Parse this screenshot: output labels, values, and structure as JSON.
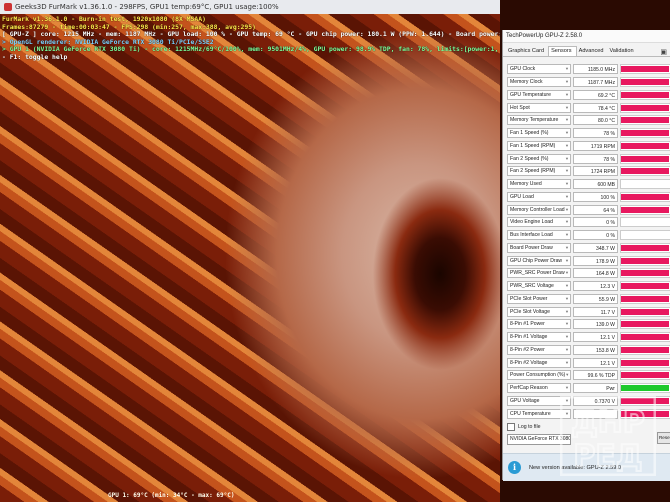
{
  "furmark": {
    "title": "Geeks3D FurMark v1.36.1.0 - 298FPS, GPU1 temp:69°C, GPU1 usage:100%",
    "overlay": [
      {
        "text": "FurMark v1.36.1.0 - Burn-in test, 1920x1080 (8X MSAA)",
        "color": "y"
      },
      {
        "text": "Frames:87279 - time:00:03:47 - FPS:298 (min:257, max:388, avg:295)",
        "color": "y"
      },
      {
        "text": "[ GPU-Z ] core: 1215 MHz - mem: 1187 MHz - GPU load: 100 % - GPU temp: 69 °C - GPU chip power: 180.1 W (PPW: 1.644) - Board power: 348.7 W (PPW: 0.848) - GPU voltage: 0.737 V",
        "color": "w"
      },
      {
        "text": "> OpenGL renderer: NVIDIA GeForce RTX 3080 Ti/PCIe/SSE2",
        "color": "c"
      },
      {
        "text": "> GPU 1 (NVIDIA GeForce RTX 3080 Ti) - core: 1215MHz/69°C/100%, mem: 9501MHz/4%, GPU power: 98.9% TDP, fan: 78%, limits:[power:1, temp:0, volt:0, OV:0]",
        "color": "g"
      },
      {
        "text": "- F1: toggle help",
        "color": "w"
      }
    ],
    "footer": "GPU 1: 69°C (min: 34°C - max: 69°C)"
  },
  "gpuz": {
    "title": "TechPowerUp GPU-Z 2.58.0",
    "tabs": [
      "Graphics Card",
      "Sensors",
      "Advanced",
      "Validation"
    ],
    "active_tab": "Sensors",
    "sensors": [
      {
        "label": "GPU Clock",
        "value": "1185.0 MHz",
        "fill": 0.98,
        "color": "pink"
      },
      {
        "label": "Memory Clock",
        "value": "1187.7 MHz",
        "fill": 0.98,
        "color": "pink"
      },
      {
        "label": "GPU Temperature",
        "value": "69.2 °C",
        "fill": 0.98,
        "color": "pink"
      },
      {
        "label": "Hot Spot",
        "value": "78.4 °C",
        "fill": 0.98,
        "color": "pink"
      },
      {
        "label": "Memory Temperature",
        "value": "80.0 °C",
        "fill": 0.98,
        "color": "pink"
      },
      {
        "label": "Fan 1 Speed (%)",
        "value": "78 %",
        "fill": 0.98,
        "color": "pink"
      },
      {
        "label": "Fan 1 Speed (RPM)",
        "value": "1719 RPM",
        "fill": 0.98,
        "color": "pink"
      },
      {
        "label": "Fan 2 Speed (%)",
        "value": "78 %",
        "fill": 0.98,
        "color": "pink"
      },
      {
        "label": "Fan 2 Speed (RPM)",
        "value": "1724 RPM",
        "fill": 0.98,
        "color": "pink"
      },
      {
        "label": "Memory Used",
        "value": "600 MB",
        "fill": 0.0,
        "color": "pink"
      },
      {
        "label": "GPU Load",
        "value": "100 %",
        "fill": 0.98,
        "color": "pink"
      },
      {
        "label": "Memory Controller Load",
        "value": "64 %",
        "fill": 0.98,
        "color": "pink"
      },
      {
        "label": "Video Engine Load",
        "value": "0 %",
        "fill": 0.0,
        "color": "pink"
      },
      {
        "label": "Bus Interface Load",
        "value": "0 %",
        "fill": 0.0,
        "color": "pink"
      },
      {
        "label": "Board Power Draw",
        "value": "348.7 W",
        "fill": 0.98,
        "color": "pink"
      },
      {
        "label": "GPU Chip Power Draw",
        "value": "178.9 W",
        "fill": 0.98,
        "color": "pink"
      },
      {
        "label": "PWR_SRC Power Draw",
        "value": "164.8 W",
        "fill": 0.98,
        "color": "pink"
      },
      {
        "label": "PWR_SRC Voltage",
        "value": "12.3 V",
        "fill": 0.98,
        "color": "pink"
      },
      {
        "label": "PCIe Slot Power",
        "value": "55.9 W",
        "fill": 0.98,
        "color": "pink"
      },
      {
        "label": "PCIe Slot Voltage",
        "value": "11.7 V",
        "fill": 0.98,
        "color": "pink"
      },
      {
        "label": "8-Pin #1 Power",
        "value": "139.0 W",
        "fill": 0.98,
        "color": "pink"
      },
      {
        "label": "8-Pin #1 Voltage",
        "value": "12.1 V",
        "fill": 0.98,
        "color": "pink"
      },
      {
        "label": "8-Pin #2 Power",
        "value": "153.8 W",
        "fill": 0.98,
        "color": "pink"
      },
      {
        "label": "8-Pin #2 Voltage",
        "value": "12.1 V",
        "fill": 0.98,
        "color": "pink"
      },
      {
        "label": "Power Consumption (%)",
        "value": "99.6 % TDP",
        "fill": 0.98,
        "color": "pink"
      },
      {
        "label": "PerfCap Reason",
        "value": "Pwr",
        "fill": 0.98,
        "color": "green"
      },
      {
        "label": "GPU Voltage",
        "value": "0.7370 V",
        "fill": 0.98,
        "color": "pink"
      },
      {
        "label": "CPU Temperature",
        "value": "",
        "fill": 0.98,
        "color": "pink"
      }
    ],
    "log_to_file": "Log to file",
    "reset_label": "Reset",
    "gpu_select": "NVIDIA GeForce RTX 3080 Ti",
    "notice": "New version available: GPU-Z 2.59.0"
  },
  "watermark": {
    "line1": "ДНР",
    "line2": "РЕД"
  }
}
